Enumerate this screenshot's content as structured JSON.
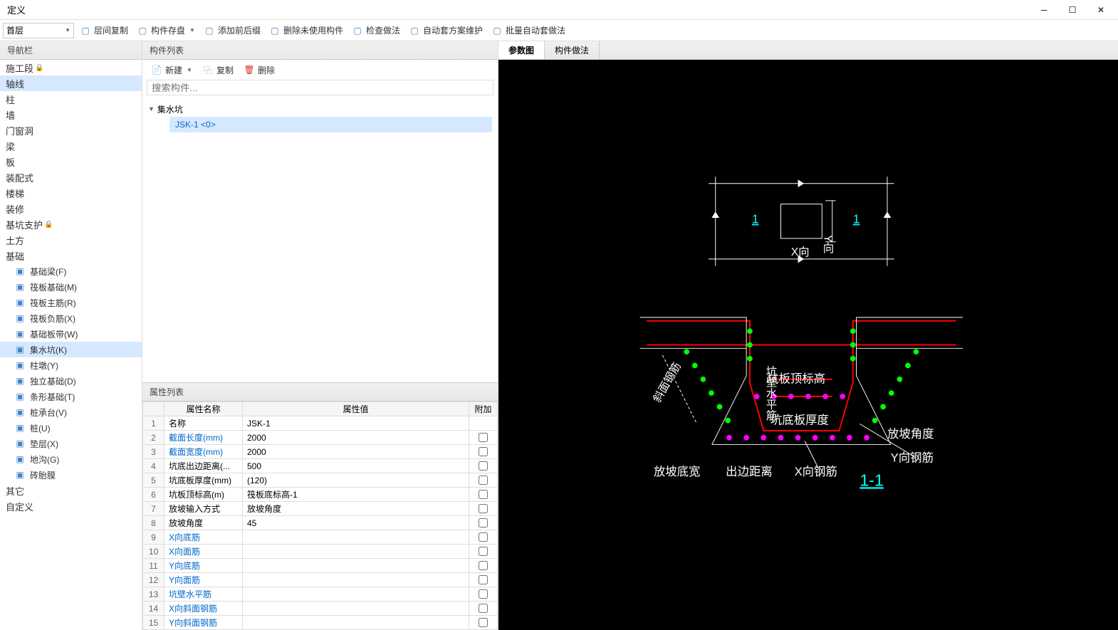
{
  "window": {
    "title": "定义"
  },
  "floor_select": "首层",
  "toolbar": [
    {
      "id": "layer-copy",
      "label": "层间复制"
    },
    {
      "id": "save-dropdown",
      "label": "构件存盘"
    },
    {
      "id": "add-prefix-suffix",
      "label": "添加前后缀"
    },
    {
      "id": "delete-unused",
      "label": "删除未使用构件"
    },
    {
      "id": "check-method",
      "label": "检查做法"
    },
    {
      "id": "auto-scheme",
      "label": "自动套方案维护"
    },
    {
      "id": "batch-auto",
      "label": "批量自动套做法"
    }
  ],
  "nav": {
    "header": "导航栏",
    "items": [
      {
        "label": "施工段",
        "lock": true
      },
      {
        "label": "轴线",
        "selected": true
      },
      {
        "label": "柱"
      },
      {
        "label": "墙"
      },
      {
        "label": "门窗洞"
      },
      {
        "label": "梁"
      },
      {
        "label": "板"
      },
      {
        "label": "装配式"
      },
      {
        "label": "楼梯"
      },
      {
        "label": "装修"
      },
      {
        "label": "基坑支护",
        "lock": true
      },
      {
        "label": "土方"
      },
      {
        "label": "基础",
        "expanded": true,
        "sub": [
          {
            "label": "基础梁(F)"
          },
          {
            "label": "筏板基础(M)"
          },
          {
            "label": "筏板主筋(R)"
          },
          {
            "label": "筏板负筋(X)"
          },
          {
            "label": "基础板带(W)"
          },
          {
            "label": "集水坑(K)",
            "selected": true
          },
          {
            "label": "柱墩(Y)"
          },
          {
            "label": "独立基础(D)"
          },
          {
            "label": "条形基础(T)"
          },
          {
            "label": "桩承台(V)"
          },
          {
            "label": "桩(U)"
          },
          {
            "label": "垫层(X)"
          },
          {
            "label": "地沟(G)"
          },
          {
            "label": "砖胎膜"
          }
        ]
      },
      {
        "label": "其它"
      },
      {
        "label": "自定义"
      }
    ]
  },
  "midpanel": {
    "header": "构件列表",
    "toolbar": [
      {
        "id": "new",
        "label": "新建"
      },
      {
        "id": "copy",
        "label": "复制"
      },
      {
        "id": "delete",
        "label": "删除"
      }
    ],
    "search_placeholder": "搜索构件...",
    "tree_root": "集水坑",
    "tree_item": "JSK-1 <0>"
  },
  "props": {
    "header": "属性列表",
    "cols": [
      "",
      "属性名称",
      "属性值",
      "附加"
    ],
    "rows": [
      {
        "n": "1",
        "name": "名称",
        "value": "JSK-1",
        "link": false,
        "check": false
      },
      {
        "n": "2",
        "name": "截面长度(mm)",
        "value": "2000",
        "link": true,
        "check": true
      },
      {
        "n": "3",
        "name": "截面宽度(mm)",
        "value": "2000",
        "link": true,
        "check": true
      },
      {
        "n": "4",
        "name": "坑底出边距离(...",
        "value": "500",
        "link": false,
        "check": true
      },
      {
        "n": "5",
        "name": "坑底板厚度(mm)",
        "value": "(120)",
        "link": false,
        "check": true
      },
      {
        "n": "6",
        "name": "坑板顶标高(m)",
        "value": "筏板底标高-1",
        "link": false,
        "check": true
      },
      {
        "n": "7",
        "name": "放坡输入方式",
        "value": "放坡角度",
        "link": false,
        "check": true
      },
      {
        "n": "8",
        "name": "放坡角度",
        "value": "45",
        "link": false,
        "check": true
      },
      {
        "n": "9",
        "name": "X向底筋",
        "value": "",
        "link": true,
        "check": true
      },
      {
        "n": "10",
        "name": "X向面筋",
        "value": "",
        "link": true,
        "check": true
      },
      {
        "n": "11",
        "name": "Y向底筋",
        "value": "",
        "link": true,
        "check": true
      },
      {
        "n": "12",
        "name": "Y向面筋",
        "value": "",
        "link": true,
        "check": true
      },
      {
        "n": "13",
        "name": "坑壁水平筋",
        "value": "",
        "link": true,
        "check": true
      },
      {
        "n": "14",
        "name": "X向斜面钢筋",
        "value": "",
        "link": true,
        "check": true
      },
      {
        "n": "15",
        "name": "Y向斜面钢筋",
        "value": "",
        "link": true,
        "check": true
      }
    ]
  },
  "diagram": {
    "tabs": [
      {
        "label": "参数图",
        "active": true
      },
      {
        "label": "构件做法"
      }
    ],
    "labels": {
      "x_dir": "X向",
      "y_dir": "Y向",
      "one": "1",
      "one_b": "1",
      "wall_h": "坑壁水平筋",
      "top_elev": "坑板顶标高",
      "bottom_thick": "坑底板厚度",
      "slope_angle": "放坡角度",
      "slope_bottom": "放坡底宽",
      "out_dist": "出边距离",
      "x_rebar": "X向钢筋",
      "y_rebar": "Y向钢筋",
      "slant_rebar": "斜面钢筋",
      "section": "1-1"
    }
  },
  "chart_data": {
    "type": "diagram",
    "description": "Engineering cross-section diagram of a sump pit (集水坑) showing plan view (top) and section 1-1 (bottom) with rebar arrangement, slope angles, and dimension labels",
    "plan_view": {
      "labels": [
        "X向",
        "Y向"
      ],
      "section_marks": [
        "1",
        "1"
      ]
    },
    "section_view": {
      "name": "1-1",
      "annotations": [
        "坑壁水平筋",
        "坑板顶标高",
        "坑底板厚度",
        "放坡角度",
        "放坡底宽",
        "出边距离",
        "X向钢筋",
        "Y向钢筋",
        "斜面钢筋"
      ]
    }
  }
}
